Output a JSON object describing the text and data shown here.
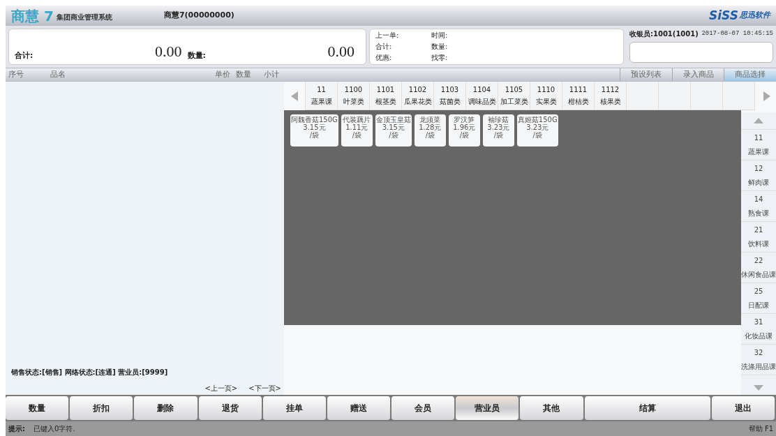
{
  "header": {
    "logo_mark": "商慧 7",
    "logo_subtitle": "集团商业管理系统",
    "store": "商慧7(00000000)",
    "brand": "SiSS",
    "brand_subtitle": "思迅软件"
  },
  "totals": [
    {
      "label": "合计:",
      "value": "0.00"
    },
    {
      "label": "数量:",
      "value": "0.00"
    }
  ],
  "last_order": [
    {
      "label": "上一单:"
    },
    {
      "label": "时间:"
    },
    {
      "label": "合计:"
    },
    {
      "label": "数量:"
    },
    {
      "label": "优惠:"
    },
    {
      "label": "找零:"
    }
  ],
  "cashier": {
    "label": "收银员:1001(1001)",
    "datetime": "2017-08-07 10:45:15"
  },
  "columns": [
    "序号",
    "品名",
    "单价",
    "数量",
    "小计"
  ],
  "view_tabs": [
    {
      "label": "预设列表",
      "selected": false
    },
    {
      "label": "录入商品",
      "selected": false
    },
    {
      "label": "商品选择",
      "selected": true
    }
  ],
  "categories": [
    {
      "code": "11",
      "name": "蔬果课"
    },
    {
      "code": "1100",
      "name": "叶菜类"
    },
    {
      "code": "1101",
      "name": "根茎类"
    },
    {
      "code": "1102",
      "name": "瓜果花类"
    },
    {
      "code": "1103",
      "name": "菇菌类"
    },
    {
      "code": "1104",
      "name": "调味品类"
    },
    {
      "code": "1105",
      "name": "加工菜类"
    },
    {
      "code": "1110",
      "name": "实果类"
    },
    {
      "code": "1111",
      "name": "柑桔类"
    },
    {
      "code": "1112",
      "name": "核果类"
    }
  ],
  "products": [
    {
      "name": "阿魏香菇150G",
      "price": "3.15元",
      "unit": "/袋"
    },
    {
      "name": "代装藕片",
      "price": "1.11元",
      "unit": "/袋"
    },
    {
      "name": "金顶玉皇菇",
      "price": "3.15元",
      "unit": "/袋"
    },
    {
      "name": "龙须菜",
      "price": "1.28元",
      "unit": "/袋"
    },
    {
      "name": "罗汉笋",
      "price": "1.96元",
      "unit": "/袋"
    },
    {
      "name": "袖珍菇",
      "price": "3.23元",
      "unit": "/袋"
    },
    {
      "name": "真姬菇150G",
      "price": "3.23元",
      "unit": "/袋"
    }
  ],
  "departments": [
    {
      "code": "11",
      "name": "蔬果课"
    },
    {
      "code": "12",
      "name": "鲜肉课"
    },
    {
      "code": "14",
      "name": "熟食课"
    },
    {
      "code": "21",
      "name": "饮料课"
    },
    {
      "code": "22",
      "name": "休闲食品课"
    },
    {
      "code": "25",
      "name": "日配课"
    },
    {
      "code": "31",
      "name": "化妆品课"
    },
    {
      "code": "32",
      "name": "洗涤用品课"
    }
  ],
  "status_line": "销售状态:[销售] 网络状态:[连通] 营业员:[9999]",
  "pager": [
    "<上一页>",
    "<下一页>"
  ],
  "actions": [
    {
      "label": "数量",
      "selected": false,
      "wide": false
    },
    {
      "label": "折扣",
      "selected": false,
      "wide": false
    },
    {
      "label": "删除",
      "selected": false,
      "wide": false
    },
    {
      "label": "退货",
      "selected": false,
      "wide": false
    },
    {
      "label": "挂单",
      "selected": false,
      "wide": false
    },
    {
      "label": "赠送",
      "selected": false,
      "wide": false
    },
    {
      "label": "会员",
      "selected": false,
      "wide": false
    },
    {
      "label": "营业员",
      "selected": true,
      "wide": false
    },
    {
      "label": "其他",
      "selected": false,
      "wide": false
    },
    {
      "label": "结算",
      "selected": false,
      "wide": true
    },
    {
      "label": "退出",
      "selected": false,
      "wide": false
    }
  ],
  "status_bar": {
    "hint_label": "提示:",
    "hint": "已键入0字符.",
    "help": "帮助 F1"
  }
}
